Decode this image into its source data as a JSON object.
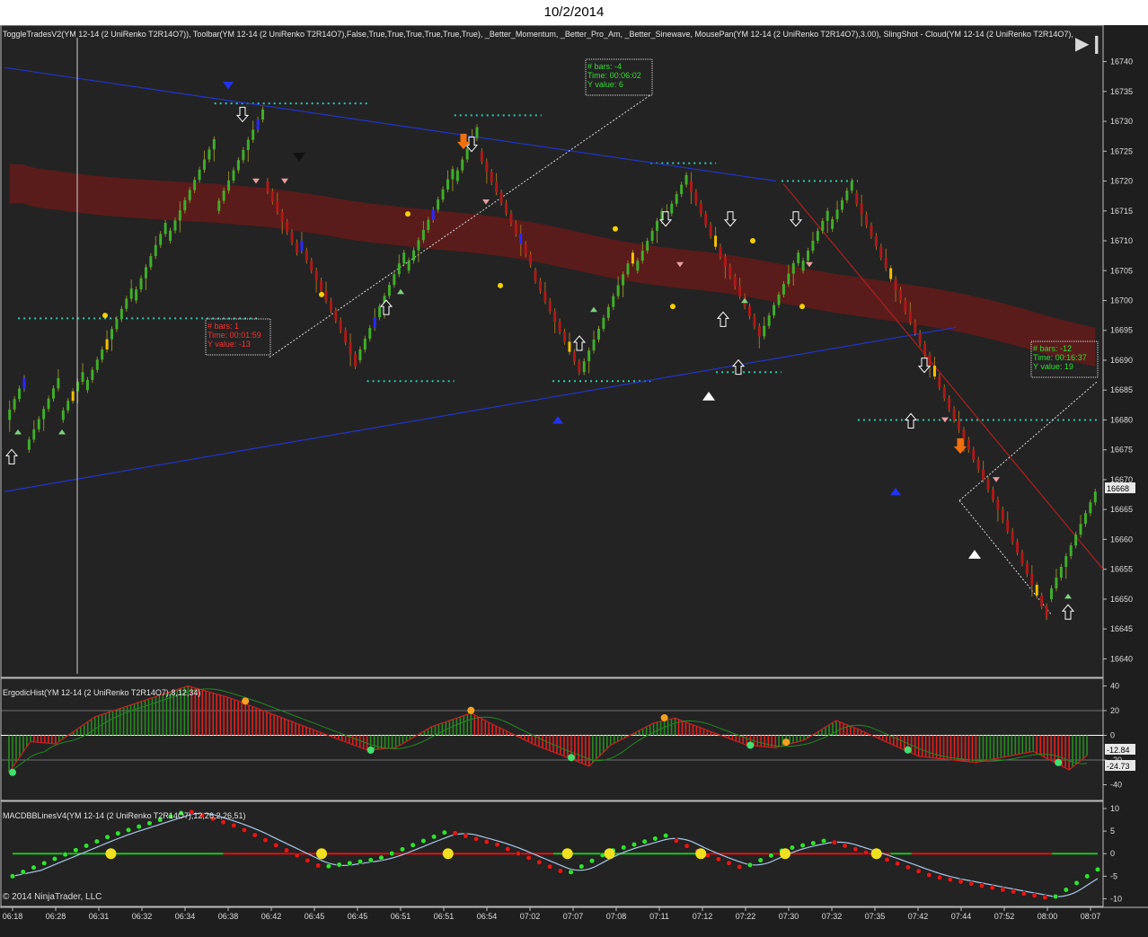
{
  "window": {
    "title": "10/2/2014"
  },
  "price_panel": {
    "indicator_line": "ToggleTradesV2(YM 12-14 (2 UniRenko T2R14O7)), Toolbar(YM 12-14 (2 UniRenko T2R14O7),False,True,True,True,True,True,True), _Better_Momentum, _Better_Pro_Am, _Better_Sinewave, MousePan(YM 12-14 (2 UniRenko T2R14O7),3.00), SlingShot - Cloud(YM 12-14 (2 UniRenko T2R14O7),200,W",
    "last_price": "16668",
    "play_button": "▶❙"
  },
  "measure_boxes": [
    {
      "bars": "# bars:  1",
      "time": "Time:    00:01:59",
      "value": "Y value: -13",
      "color": "#ff3030"
    },
    {
      "bars": "# bars:  -4",
      "time": "Time:    00:06:02",
      "value": "Y value: 6",
      "color": "#33dd33"
    },
    {
      "bars": "# bars:  -12",
      "time": "Time:    00:16:37",
      "value": "Y value: 19",
      "color": "#33dd33"
    }
  ],
  "ergodic_panel": {
    "label": "ErgodicHist(YM 12-14 (2 UniRenko T2R14O7),8,12,34)",
    "value1": "-12.84",
    "value2": "-24.73"
  },
  "macd_panel": {
    "label": "MACDBBLinesV4(YM 12-14 (2 UniRenko T2R14O7),12,26,2,26,51)"
  },
  "copyright": "© 2014 NinjaTrader, LLC",
  "chart_data": [
    {
      "type": "bar",
      "title": "",
      "y_ticks": [
        16740,
        16735,
        16730,
        16725,
        16720,
        16715,
        16710,
        16705,
        16700,
        16695,
        16690,
        16685,
        16680,
        16675,
        16670,
        16665,
        16660,
        16655,
        16650,
        16645,
        16640
      ],
      "ylim": [
        16637.5,
        16745.5
      ],
      "x_tick_labels": [
        "06:18",
        "06:28",
        "06:31",
        "06:32",
        "06:34",
        "06:38",
        "06:42",
        "06:45",
        "06:45",
        "06:51",
        "06:51",
        "06:54",
        "07:02",
        "07:07",
        "07:08",
        "07:11",
        "07:12",
        "07:22",
        "07:30",
        "07:32",
        "07:35",
        "07:42",
        "07:44",
        "07:52",
        "08:00",
        "08:07"
      ],
      "segments": [
        [
          16680,
          16687,
          "g"
        ],
        [
          16675,
          16687,
          "g"
        ],
        [
          16680,
          16688,
          "g"
        ],
        [
          16685,
          16702,
          "g"
        ],
        [
          16700,
          16713,
          "g"
        ],
        [
          16710,
          16727,
          "g"
        ],
        [
          16715,
          16732,
          "g"
        ],
        [
          16720,
          16708,
          "r"
        ],
        [
          16710,
          16695,
          "r"
        ],
        [
          16695,
          16689,
          "r"
        ],
        [
          16690,
          16708,
          "g"
        ],
        [
          16705,
          16722,
          "g"
        ],
        [
          16720,
          16729,
          "g"
        ],
        [
          16725,
          16706,
          "r"
        ],
        [
          16705,
          16688,
          "r"
        ],
        [
          16688,
          16708,
          "g"
        ],
        [
          16705,
          16715,
          "g"
        ],
        [
          16713,
          16721,
          "g"
        ],
        [
          16720,
          16709,
          "r"
        ],
        [
          16709,
          16694,
          "r"
        ],
        [
          16694,
          16708,
          "g"
        ],
        [
          16705,
          16715,
          "g"
        ],
        [
          16712,
          16720,
          "g"
        ],
        [
          16718,
          16700,
          "r"
        ],
        [
          16700,
          16680,
          "r"
        ],
        [
          16680,
          16665,
          "r"
        ],
        [
          16665,
          16647,
          "r"
        ],
        [
          16650,
          16668,
          "g"
        ]
      ],
      "highlight_bars": [
        3,
        12,
        19,
        48,
        56,
        70,
        82,
        98,
        108,
        120,
        136,
        170,
        178,
        198
      ]
    },
    {
      "type": "bar",
      "title": "",
      "y_ticks": [
        40,
        20,
        0,
        -20,
        -40
      ],
      "ylim": [
        -52,
        44
      ],
      "histogram_pivots": [
        [
          0,
          -30
        ],
        [
          6,
          -5
        ],
        [
          13,
          -7
        ],
        [
          24,
          15
        ],
        [
          50,
          40
        ],
        [
          62,
          30
        ],
        [
          80,
          10
        ],
        [
          100,
          -12
        ],
        [
          108,
          -10
        ],
        [
          118,
          7
        ],
        [
          129,
          18
        ],
        [
          135,
          9
        ],
        [
          147,
          -8
        ],
        [
          156,
          -18
        ],
        [
          162,
          -25
        ],
        [
          168,
          -8
        ],
        [
          180,
          10
        ],
        [
          186,
          14
        ],
        [
          196,
          3
        ],
        [
          206,
          -8
        ],
        [
          214,
          -10
        ],
        [
          222,
          -4
        ],
        [
          231,
          12
        ],
        [
          237,
          5
        ],
        [
          254,
          -17
        ],
        [
          270,
          -22
        ],
        [
          286,
          -13
        ],
        [
          296,
          -28
        ],
        [
          302,
          -14
        ]
      ]
    },
    {
      "type": "line",
      "title": "",
      "y_ticks": [
        10,
        5,
        0,
        -5,
        -10
      ],
      "ylim": [
        -11.5,
        11
      ],
      "macd_pivots": [
        [
          0,
          -5
        ],
        [
          28,
          4
        ],
        [
          50,
          9.5
        ],
        [
          64,
          6
        ],
        [
          88,
          -3
        ],
        [
          104,
          -1.2
        ],
        [
          124,
          5
        ],
        [
          138,
          2
        ],
        [
          158,
          -4.5
        ],
        [
          170,
          0.5
        ],
        [
          186,
          4
        ],
        [
          196,
          0.2
        ],
        [
          208,
          -3.2
        ],
        [
          220,
          1
        ],
        [
          232,
          3
        ],
        [
          246,
          -0.5
        ],
        [
          262,
          -5
        ],
        [
          282,
          -8
        ],
        [
          296,
          -10
        ],
        [
          310,
          -3
        ]
      ]
    }
  ]
}
